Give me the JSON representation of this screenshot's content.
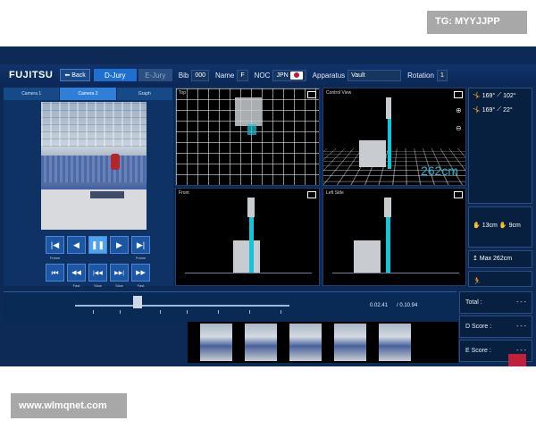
{
  "watermarks": {
    "top": "TG: MYYJJPP",
    "bottom": "www.wlmqnet.com"
  },
  "topbar": {
    "logo": "FUJITSU",
    "back_label": "Back",
    "tab_djury": "D-Jury",
    "tab_ejury": "E-Jury",
    "bib_label": "Bib",
    "bib_value": "000",
    "name_label": "Name",
    "name_value": "F",
    "noc_label": "NOC",
    "noc_value": "JPN",
    "apparatus_label": "Apparatus",
    "apparatus_value": "Vault",
    "rotation_label": "Rotation",
    "rotation_value": "1"
  },
  "camera_tabs": [
    "Camera 1",
    "Camera 2",
    "Graph"
  ],
  "controls": {
    "row1": [
      {
        "icon": "step-back-icon",
        "glyph": "|◀",
        "caption": "Frame"
      },
      {
        "icon": "play-reverse-icon",
        "glyph": "◀",
        "caption": ""
      },
      {
        "icon": "pause-icon",
        "glyph": "❚❚",
        "caption": ""
      },
      {
        "icon": "play-icon",
        "glyph": "▶",
        "caption": ""
      },
      {
        "icon": "step-forward-icon",
        "glyph": "▶|",
        "caption": "Frame"
      }
    ],
    "row2": [
      {
        "icon": "skip-start-icon",
        "glyph": "⏮",
        "caption": ""
      },
      {
        "icon": "rewind-fast-icon",
        "glyph": "◀◀",
        "caption": "Fast"
      },
      {
        "icon": "rewind-slow-icon",
        "glyph": "|◀◀",
        "caption": "Slow"
      },
      {
        "icon": "forward-slow-icon",
        "glyph": "▶▶|",
        "caption": "Slow"
      },
      {
        "icon": "forward-fast-icon",
        "glyph": "▶▶",
        "caption": "Fast"
      }
    ]
  },
  "views": {
    "top": "Top",
    "control": "Control View",
    "front": "Front",
    "left_side": "Left Side",
    "distance": "262cm"
  },
  "angles": {
    "a1": "169°",
    "a2": "102°",
    "a3": "169°",
    "a4": "22°",
    "d1": "13cm",
    "d2": "9cm",
    "max": "Max 262cm"
  },
  "timeline": {
    "current": "0.02.41",
    "total": "/ 0.10.94"
  },
  "scores": {
    "total_label": "Total :",
    "total_value": "- - -",
    "d_label": "D Score :",
    "d_value": "- - -",
    "e_label": "E Score :",
    "e_value": "- - -"
  },
  "colors": {
    "accent": "#1f6fd1",
    "cyan": "#14c4d8",
    "bg": "#0c2a55"
  }
}
